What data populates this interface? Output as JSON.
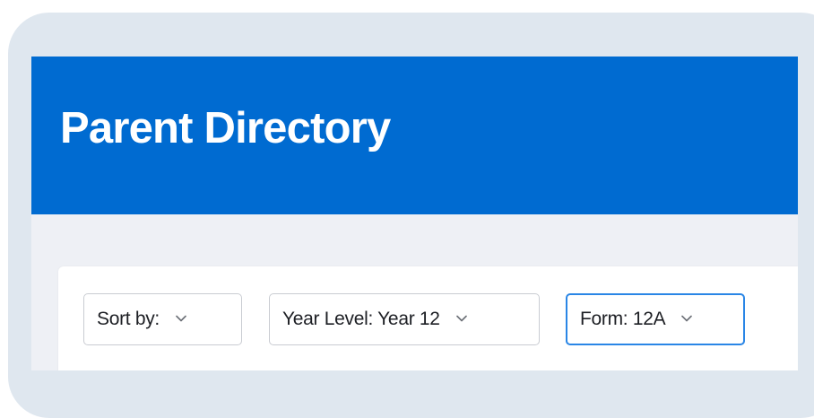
{
  "header": {
    "title": "Parent Directory",
    "background_color": "#006bd1"
  },
  "filters": {
    "sort": {
      "label": "Sort by:",
      "icon": "chevron-down-icon"
    },
    "year_level": {
      "label": "Year Level: Year 12",
      "icon": "chevron-down-icon"
    },
    "form": {
      "label": "Form: 12A",
      "icon": "chevron-down-icon",
      "focused": true
    }
  },
  "colors": {
    "frame": "#dfe7ef",
    "focus_border": "#2a86e6"
  }
}
